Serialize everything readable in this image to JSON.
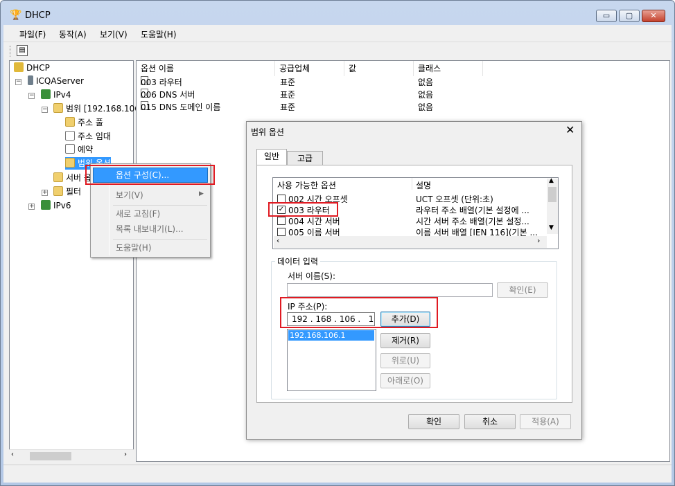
{
  "window": {
    "title": "DHCP",
    "controls": {
      "minimize": "▭",
      "maximize": "▢",
      "close": "✕"
    }
  },
  "menu": [
    "파일(F)",
    "동작(A)",
    "보기(V)",
    "도움말(H)"
  ],
  "tree": {
    "root": "DHCP",
    "server": "ICQAServer",
    "ipv4": "IPv4",
    "scope": "범위 [192.168.106",
    "scope_children": [
      "주소 풀",
      "주소 임대",
      "예약",
      "범위 옵션"
    ],
    "server_options": "서버 옵",
    "filters": "필터",
    "ipv6": "IPv6"
  },
  "list": {
    "columns": [
      "옵션 이름",
      "공급업체",
      "값",
      "클래스"
    ],
    "rows": [
      {
        "name": "003 라우터",
        "vendor": "표준",
        "value": "",
        "class": "없음"
      },
      {
        "name": "006 DNS 서버",
        "vendor": "표준",
        "value": "",
        "class": "없음"
      },
      {
        "name": "015 DNS 도메인 이름",
        "vendor": "표준",
        "value": "",
        "class": "없음"
      }
    ]
  },
  "context_menu": {
    "items": [
      "옵션 구성(C)...",
      "보기(V)",
      "새로 고침(F)",
      "목록 내보내기(L)...",
      "도움말(H)"
    ]
  },
  "dialog": {
    "title": "범위 옵션",
    "tabs": [
      "일반",
      "고급"
    ],
    "options_list": {
      "headers": [
        "사용 가능한 옵션",
        "설명"
      ],
      "rows": [
        {
          "name": "002 시간 오프셋",
          "desc": "UCT 오프셋 (단위:초)",
          "checked": false
        },
        {
          "name": "003 라우터",
          "desc": "라우터 주소 배열(기본 설정에 ...",
          "checked": true
        },
        {
          "name": "004 시간 서버",
          "desc": "시간 서버 주소 배열(기본 설정...",
          "checked": false
        },
        {
          "name": "005 이름 서버",
          "desc": "이름 서버 배열 [IEN 116](기본 ...",
          "checked": false
        }
      ]
    },
    "data_entry": {
      "legend": "데이터 입력",
      "server_name_label": "서버 이름(S):",
      "server_name_value": "",
      "resolve_button": "확인(E)",
      "ip_label": "IP 주소(P):",
      "ip_value": "192 . 168 . 106 .   1",
      "add_button": "추가(D)",
      "ip_list": [
        "192.168.106.1"
      ],
      "remove_button": "제거(R)",
      "up_button": "위로(U)",
      "down_button": "아래로(O)"
    },
    "ok_button": "확인",
    "cancel_button": "취소",
    "apply_button": "적용(A)"
  },
  "colors": {
    "highlight": "#3399ff",
    "annotation_red": "#e01a22"
  }
}
